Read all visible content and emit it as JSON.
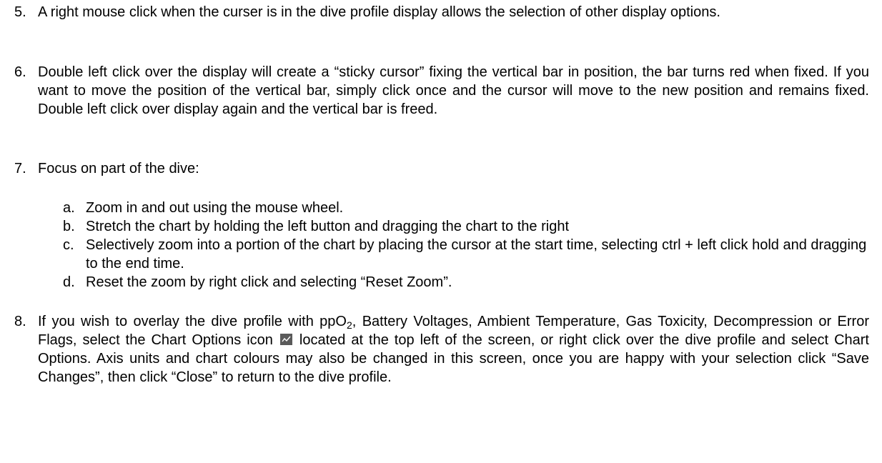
{
  "items": [
    {
      "number": "5.",
      "text": "A right mouse click when the curser is in the dive profile display allows the selection of other display options."
    },
    {
      "number": "6.",
      "text": "Double left click over the display will create a “sticky cursor” fixing the vertical bar in position, the bar turns red when fixed. If you want to move the position of the vertical bar, simply click once and the cursor will move to the new position and remains fixed. Double left click over display again and the vertical bar is freed."
    },
    {
      "number": "7.",
      "text": "Focus on part of the dive:",
      "subitems": [
        {
          "letter": "a.",
          "text": "Zoom in and out using the mouse wheel."
        },
        {
          "letter": "b.",
          "text": "Stretch the chart by holding the left button and dragging the chart to the right"
        },
        {
          "letter": "c.",
          "text": "Selectively zoom into a portion of the chart by placing the cursor at the start time, selecting ctrl + left click hold and dragging to the end time."
        },
        {
          "letter": "d.",
          "text": "Reset the zoom by right click and selecting “Reset Zoom”."
        }
      ]
    },
    {
      "number": "8.",
      "text_before_sub": "If you wish to overlay the dive profile with ppO",
      "sub_char": "2",
      "text_after_sub": ", Battery Voltages, Ambient Temperature, Gas Toxicity, Decompression or Error Flags, select the Chart Options icon",
      "icon": "chart-options-icon",
      "text_after_icon": "located at the top left of the screen, or right click over the dive profile and select Chart Options. Axis units and chart colours may also be changed in this screen, once you are happy with your selection click “Save Changes”, then click “Close” to return to the dive profile."
    }
  ],
  "colors": {
    "text": "#000000",
    "icon_bg": "#5a5a5a",
    "icon_line": "#ffffff"
  }
}
